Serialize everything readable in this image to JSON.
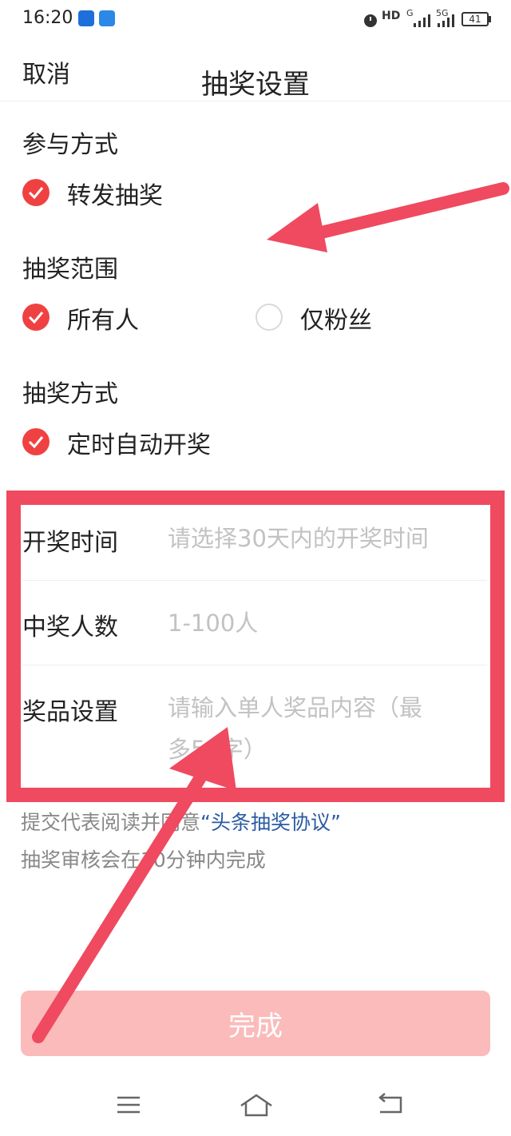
{
  "status": {
    "time": "16:20",
    "network_hd": "HD",
    "network_g": "G",
    "network_5g": "5G",
    "battery": "41"
  },
  "header": {
    "cancel_label": "取消",
    "title": "抽奖设置"
  },
  "participation": {
    "label": "参与方式",
    "options": [
      {
        "label": "转发抽奖",
        "checked": true
      }
    ]
  },
  "scope": {
    "label": "抽奖范围",
    "options": [
      {
        "label": "所有人",
        "checked": true
      },
      {
        "label": "仅粉丝",
        "checked": false
      }
    ]
  },
  "method": {
    "label": "抽奖方式",
    "options": [
      {
        "label": "定时自动开奖",
        "checked": true
      }
    ]
  },
  "form": {
    "draw_time": {
      "label": "开奖时间",
      "placeholder": "请选择30天内的开奖时间"
    },
    "winner_count": {
      "label": "中奖人数",
      "placeholder": "1-100人"
    },
    "prize": {
      "label": "奖品设置",
      "placeholder_line1": "请输入单人奖品内容（最",
      "placeholder_line2": "多50字）"
    }
  },
  "agreement": {
    "prefix": "提交代表阅读并同意",
    "link": "“头条抽奖协议”"
  },
  "review_note": "抽奖审核会在30分钟内完成",
  "done_label": "完成",
  "colors": {
    "accent": "#f04142",
    "annotation": "#ef4a5f",
    "link": "#2a5ba3",
    "done_disabled": "#fbbbbb"
  },
  "icons": [
    "shield-icon",
    "badge-icon",
    "alarm-icon",
    "signal-icon",
    "battery-icon",
    "check-icon",
    "menu-icon",
    "home-icon",
    "back-icon"
  ]
}
